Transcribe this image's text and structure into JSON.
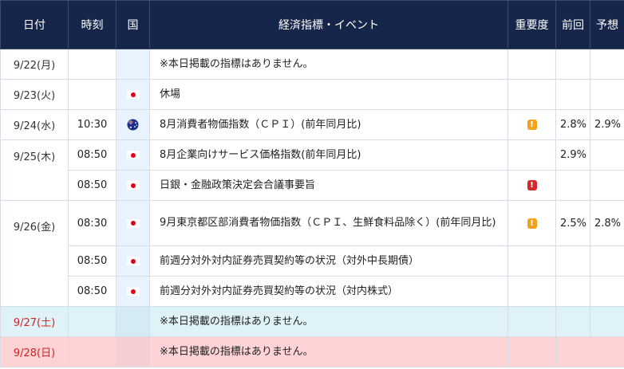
{
  "header": {
    "date": "日付",
    "time": "時刻",
    "country": "国",
    "event": "経済指標・イベント",
    "importance": "重要度",
    "previous": "前回",
    "forecast": "予想"
  },
  "rows": [
    {
      "date": "9/22(月)",
      "time": "",
      "flag": "",
      "event": "※本日掲載の指標はありません。",
      "importance": "",
      "previous": "",
      "forecast": ""
    },
    {
      "date": "9/23(火)",
      "time": "",
      "flag": "japan-flag-icon",
      "event": "休場",
      "importance": "",
      "previous": "",
      "forecast": ""
    },
    {
      "date": "9/24(水)",
      "time": "10:30",
      "flag": "australia-flag-icon",
      "event": "8月消費者物価指数（ＣＰＩ）(前年同月比)",
      "importance": "!",
      "previous": "2.8%",
      "forecast": "2.9%"
    },
    {
      "date": "9/25(木)",
      "time": "08:50",
      "flag": "japan-flag-icon",
      "event": "8月企業向けサービス価格指数(前年同月比)",
      "importance": "",
      "previous": "2.9%",
      "forecast": ""
    },
    {
      "date": "",
      "time": "08:50",
      "flag": "japan-flag-icon",
      "event": "日銀・金融政策決定会合議事要旨",
      "importance": "!",
      "previous": "",
      "forecast": ""
    },
    {
      "date": "9/26(金)",
      "time": "08:30",
      "flag": "japan-flag-icon",
      "event": "9月東京都区部消費者物価指数（ＣＰＩ、生鮮食料品除く）(前年同月比)",
      "importance": "!",
      "previous": "2.5%",
      "forecast": "2.8%"
    },
    {
      "date": "",
      "time": "08:50",
      "flag": "japan-flag-icon",
      "event": "前週分対外対内証券売買契約等の状況（対外中長期債）",
      "importance": "",
      "previous": "",
      "forecast": ""
    },
    {
      "date": "",
      "time": "08:50",
      "flag": "japan-flag-icon",
      "event": "前週分対外対内証券売買契約等の状況（対内株式）",
      "importance": "",
      "previous": "",
      "forecast": ""
    },
    {
      "date": "9/27(土)",
      "time": "",
      "flag": "",
      "event": "※本日掲載の指標はありません。",
      "importance": "",
      "previous": "",
      "forecast": ""
    },
    {
      "date": "9/28(日)",
      "time": "",
      "flag": "",
      "event": "※本日掲載の指標はありません。",
      "importance": "",
      "previous": "",
      "forecast": ""
    }
  ],
  "colors": {
    "header_bg": "#16264b",
    "importance_mid": "#f4a21a",
    "importance_high": "#d8262e",
    "weekend_date": "#d62020",
    "saturday_bg": "#dff2f8",
    "sunday_bg": "#fed3d6"
  }
}
